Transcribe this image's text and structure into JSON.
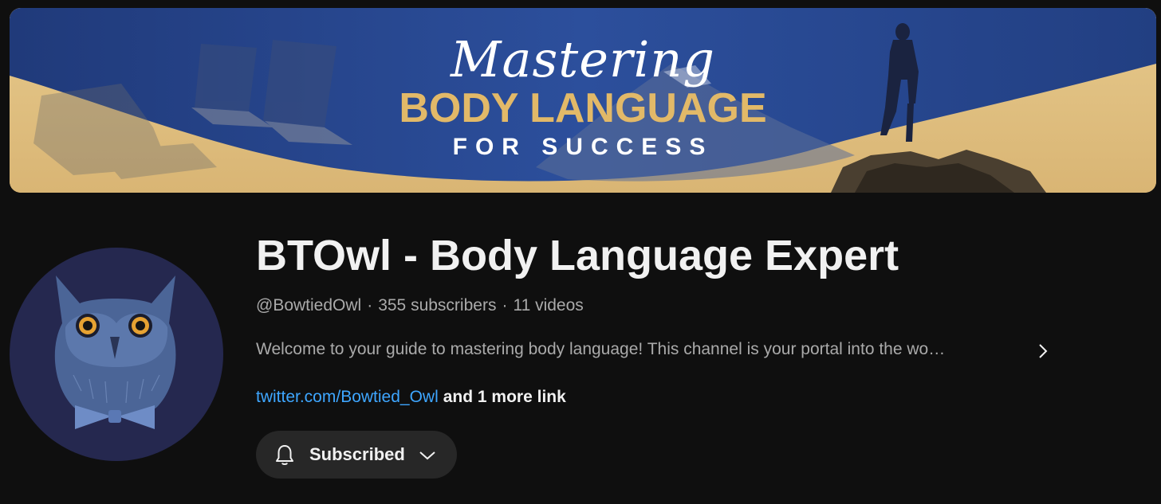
{
  "banner": {
    "script_text": "Mastering",
    "main_text": "BODY LANGUAGE",
    "sub_text": "FOR SUCCESS",
    "colors": {
      "blue": "#2a4a93",
      "gold": "#e2b968",
      "sand": "#e0c182"
    }
  },
  "avatar": {
    "icon": "owl-with-bowtie-icon",
    "bg_color": "#25284f"
  },
  "channel": {
    "title": "BTOwl - Body Language Expert",
    "handle": "@BowtiedOwl",
    "subscribers": "355 subscribers",
    "videos": "11 videos",
    "separator": "·",
    "description": "Welcome to your guide to mastering body language! This channel is your portal into the wo…",
    "link_text": "twitter.com/Bowtied_Owl",
    "more_links": "and 1 more link"
  },
  "subscribe": {
    "label": "Subscribed",
    "bell_icon": "bell-icon",
    "chevron_icon": "chevron-down-icon"
  },
  "colors": {
    "background": "#0f0f0f",
    "link": "#3ea6ff",
    "button_bg": "#272727",
    "muted_text": "#aaaaaa"
  }
}
